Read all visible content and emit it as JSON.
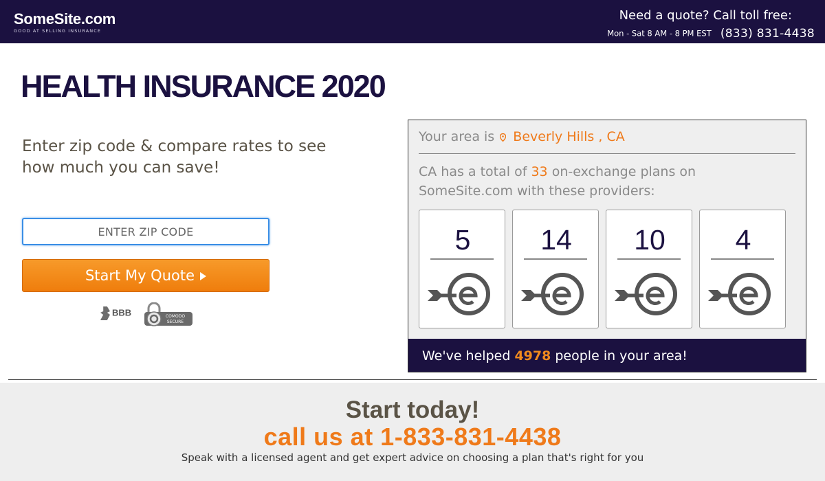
{
  "header": {
    "logo_name": "SomeSite.com",
    "logo_tagline": "GOOD AT SELLING INSURANCE",
    "quote_cta": "Need a quote? Call toll free:",
    "hours": "Mon - Sat 8 AM - 8 PM EST",
    "phone": "(833) 831-4438",
    "background_color": "#1b1140"
  },
  "main": {
    "title": "HEALTH INSURANCE 2020",
    "subhead": "Enter zip code & compare rates to see how much you can save!",
    "zip_placeholder": "ENTER ZIP CODE",
    "zip_value": "",
    "quote_button_label": "Start My Quote",
    "badges": {
      "bbb": "BBB",
      "comodo_line1": "COMODO",
      "comodo_line2": "SECURE"
    }
  },
  "panel": {
    "area_prefix": "Your area is",
    "area_location": "Beverly Hills , CA",
    "total_prefix": "CA has a total of",
    "total_count": "33",
    "total_suffix": "on-exchange plans on SomeSite.com with these providers:",
    "providers": [
      {
        "count": "5",
        "icon": "exchange-e-logo-icon"
      },
      {
        "count": "14",
        "icon": "exchange-e-logo-icon"
      },
      {
        "count": "10",
        "icon": "exchange-e-logo-icon"
      },
      {
        "count": "4",
        "icon": "exchange-e-logo-icon"
      }
    ],
    "helped_prefix": "We've helped",
    "helped_count": "4978",
    "helped_suffix": "people in your area!"
  },
  "footer": {
    "start_today": "Start today!",
    "call_us": "call us at 1-833-831-4438",
    "speak": "Speak with a licensed agent and get expert advice on choosing a plan that's right for you"
  },
  "colors": {
    "accent_orange": "#ef7a1a",
    "navy": "#1b1140"
  }
}
